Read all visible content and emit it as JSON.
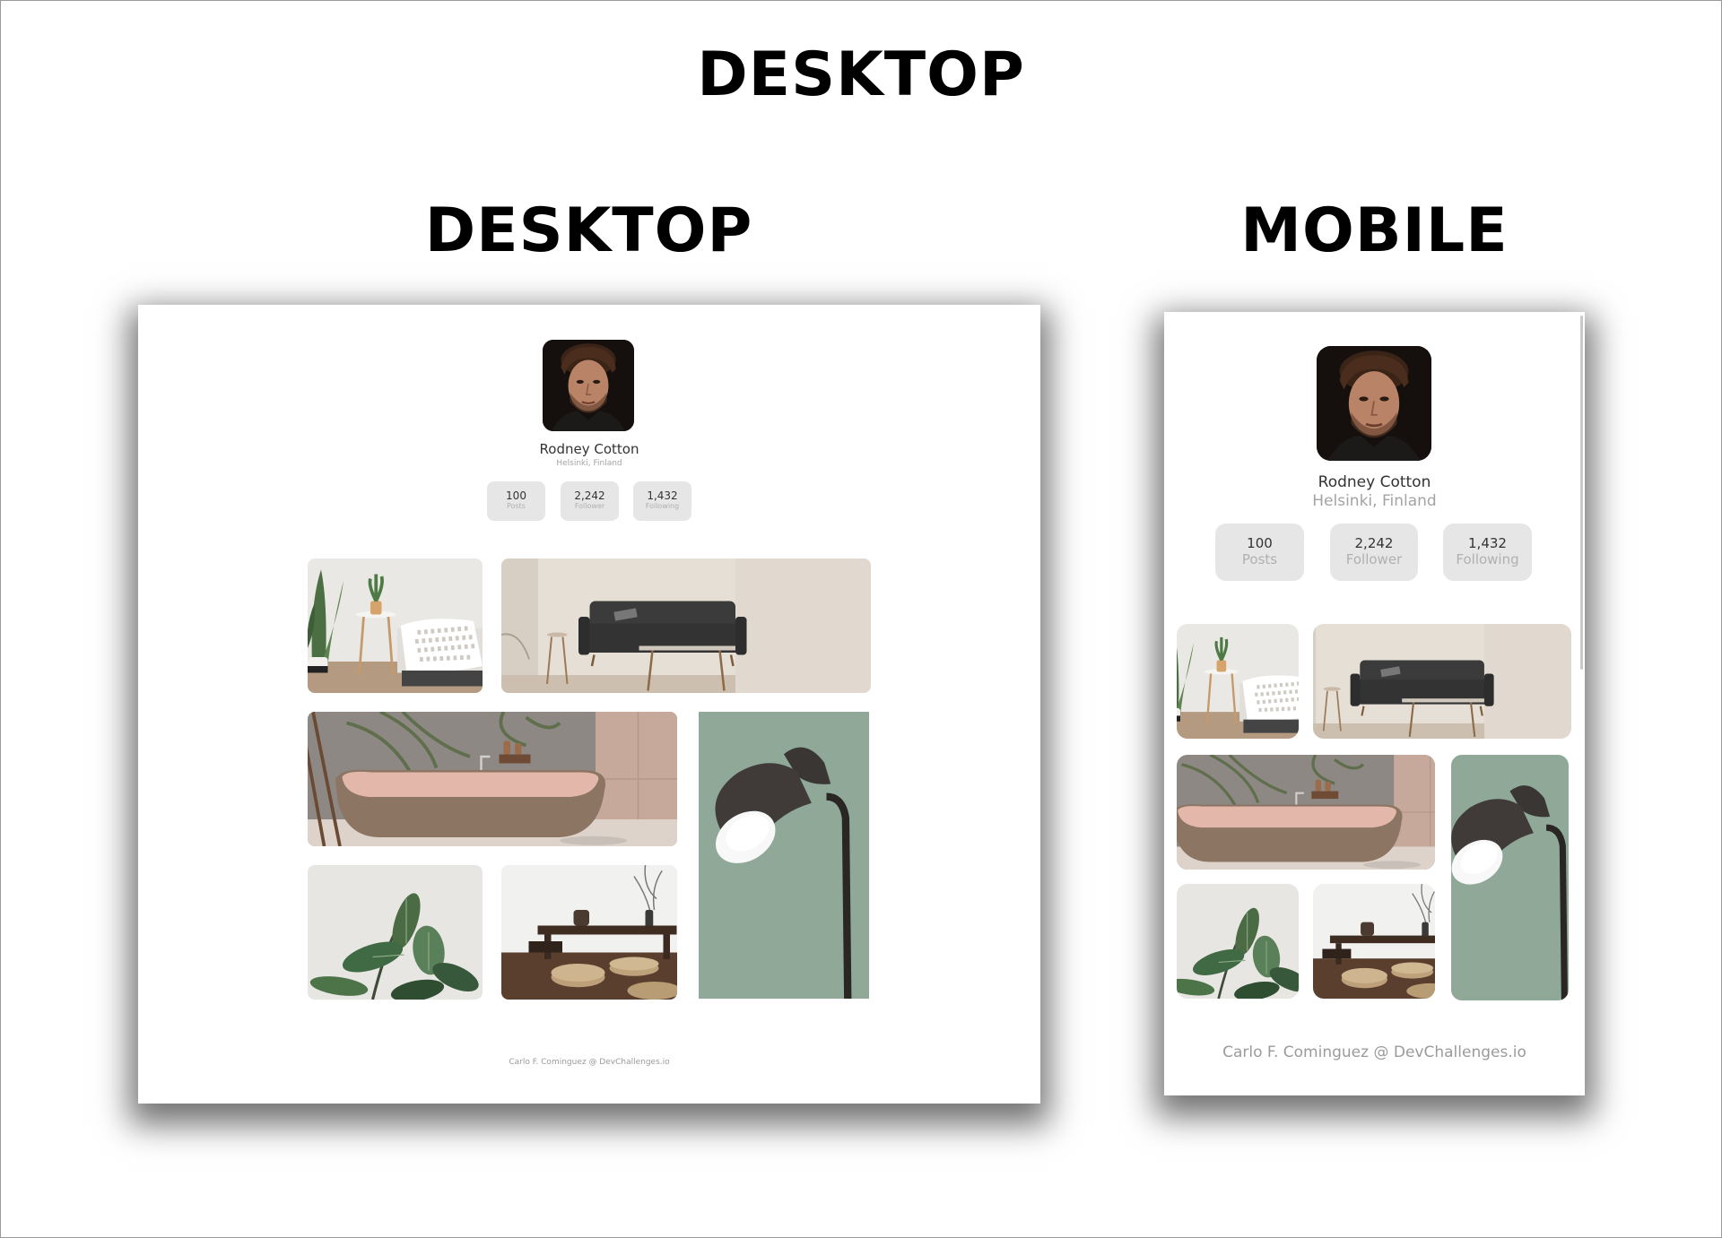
{
  "headings": {
    "main": "DESKTOP",
    "desktop": "DESKTOP",
    "mobile": "MOBILE"
  },
  "profile": {
    "name": "Rodney Cotton",
    "location": "Helsinki, Finland"
  },
  "stats": [
    {
      "value": "100",
      "label": "Posts"
    },
    {
      "value": "2,242",
      "label": "Follower"
    },
    {
      "value": "1,432",
      "label": "Following"
    }
  ],
  "gallery": {
    "images": [
      "bedroom-plant",
      "living-room-sofa",
      "bathtub",
      "floor-lamp",
      "rubber-plant",
      "low-table-cushions"
    ]
  },
  "footer": {
    "credit": "Carlo F. Cominguez @ DevChallenges.io"
  },
  "colors": {
    "stat_bg": "#e6e6e6",
    "muted_text": "#a3a3a3",
    "lamp_wall": "#8fa898"
  }
}
